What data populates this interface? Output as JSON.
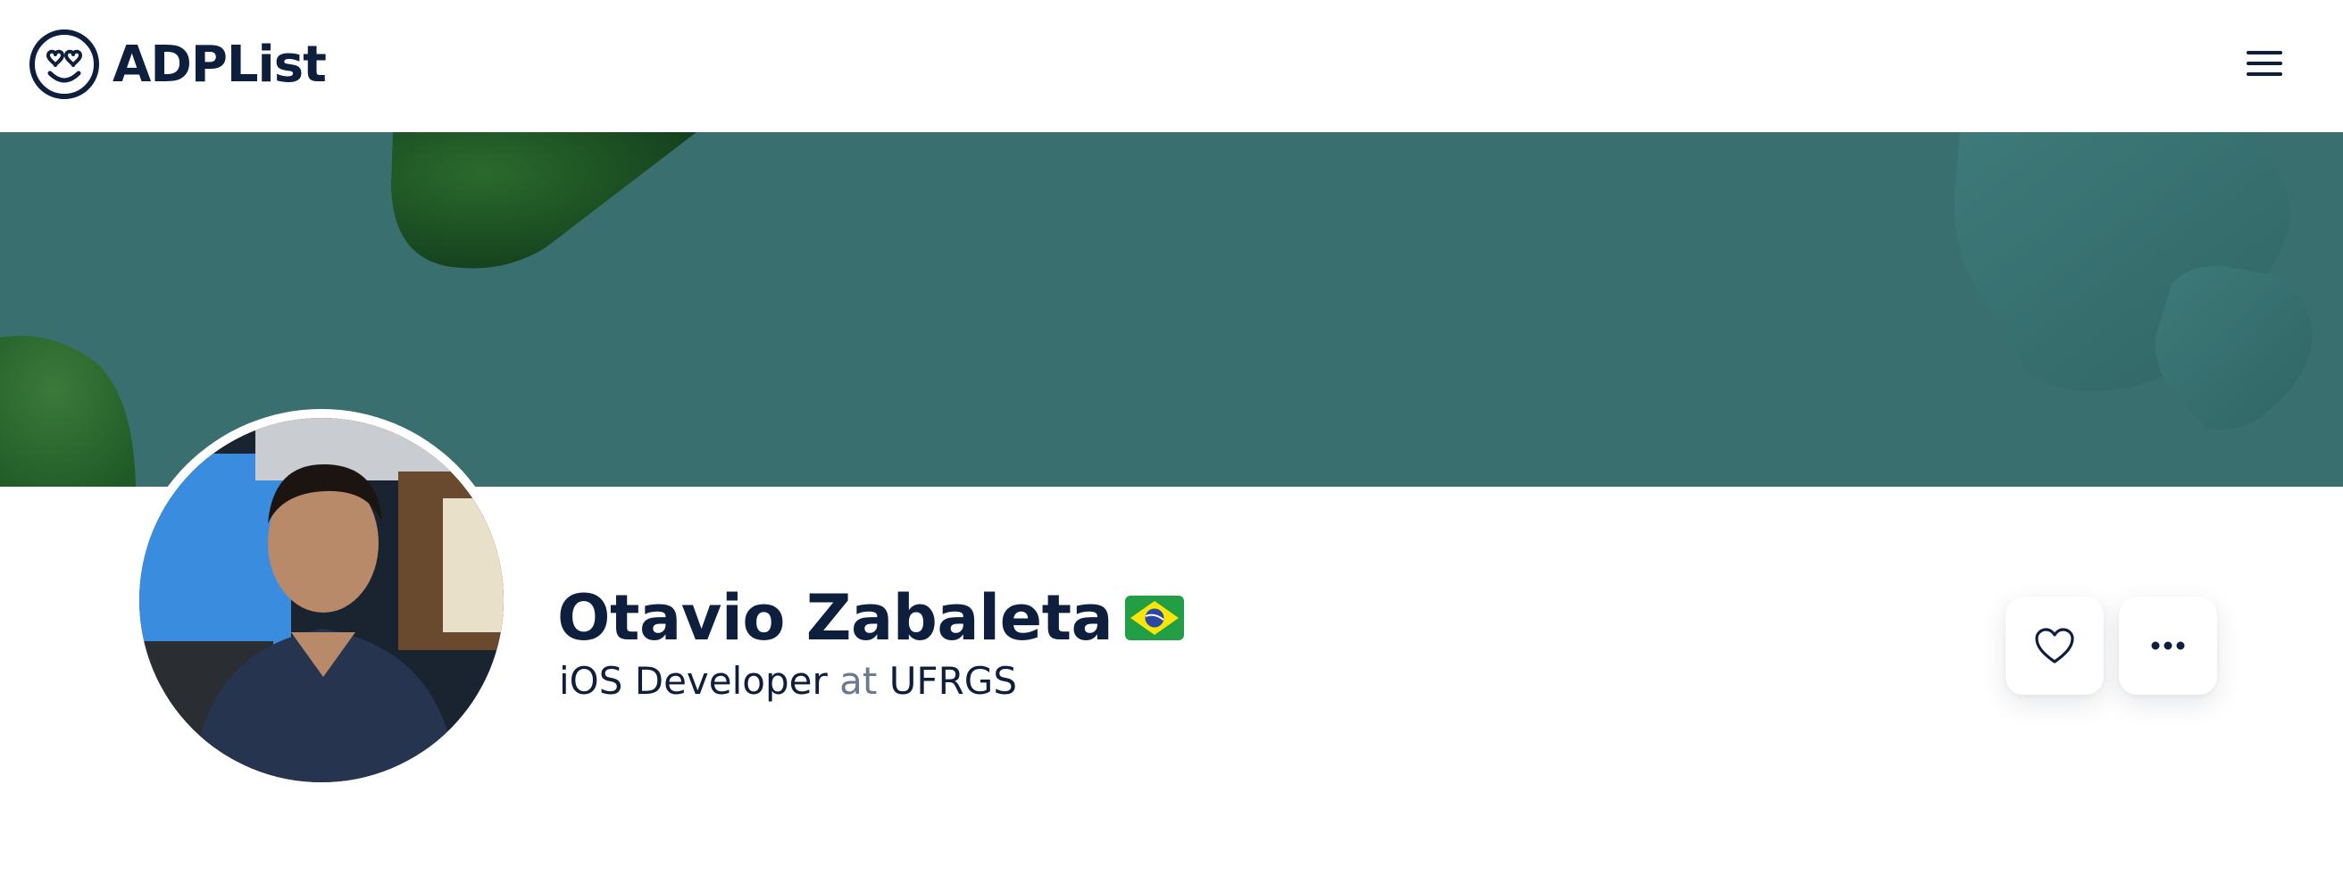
{
  "app": {
    "brand": "ADPList"
  },
  "nav": {
    "menu_icon": "hamburger-menu-icon"
  },
  "profile": {
    "name": "Otavio Zabaleta",
    "country_flag_icon": "brazil-flag-icon",
    "role": "iOS Developer",
    "at_word": "at",
    "company": "UFRGS"
  },
  "actions": {
    "favorite_icon": "heart-icon",
    "more_icon": "more-horizontal-icon"
  },
  "colors": {
    "brand_navy": "#0d1f3c",
    "banner_teal": "#3a6f6f",
    "muted_text": "#6b7a90"
  }
}
